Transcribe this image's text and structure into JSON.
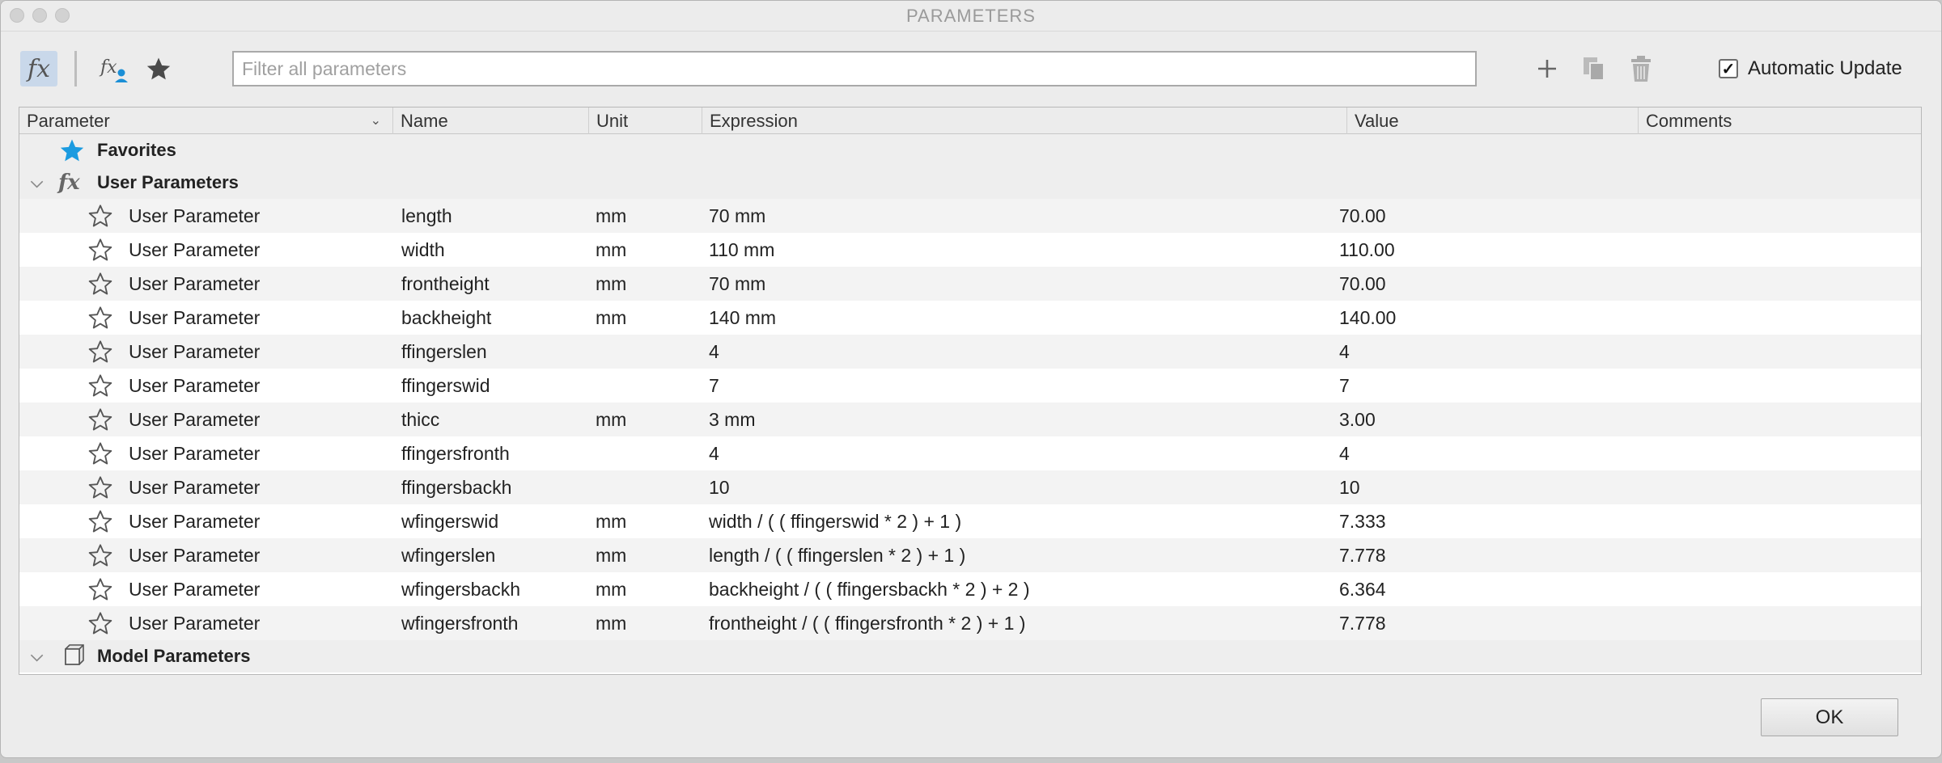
{
  "window": {
    "title": "PARAMETERS"
  },
  "toolbar": {
    "search_placeholder": "Filter all parameters",
    "auto_update_label": "Automatic Update",
    "auto_update_checked": true,
    "icons": [
      "fx-icon",
      "user-fx-icon",
      "star-icon",
      "plus-icon",
      "copy-icon",
      "trash-icon"
    ]
  },
  "columns": [
    "Parameter",
    "Name",
    "Unit",
    "Expression",
    "Value",
    "Comments"
  ],
  "groups": {
    "favorites": "Favorites",
    "user": "User Parameters",
    "model": "Model Parameters"
  },
  "rows": [
    {
      "parameter": "User Parameter",
      "name": "length",
      "unit": "mm",
      "expression": "70 mm",
      "value": "70.00",
      "comments": ""
    },
    {
      "parameter": "User Parameter",
      "name": "width",
      "unit": "mm",
      "expression": "110 mm",
      "value": "110.00",
      "comments": ""
    },
    {
      "parameter": "User Parameter",
      "name": "frontheight",
      "unit": "mm",
      "expression": "70 mm",
      "value": "70.00",
      "comments": ""
    },
    {
      "parameter": "User Parameter",
      "name": "backheight",
      "unit": "mm",
      "expression": "140 mm",
      "value": "140.00",
      "comments": ""
    },
    {
      "parameter": "User Parameter",
      "name": "ffingerslen",
      "unit": "",
      "expression": "4",
      "value": "4",
      "comments": ""
    },
    {
      "parameter": "User Parameter",
      "name": "ffingerswid",
      "unit": "",
      "expression": "7",
      "value": "7",
      "comments": ""
    },
    {
      "parameter": "User Parameter",
      "name": "thicc",
      "unit": "mm",
      "expression": "3 mm",
      "value": "3.00",
      "comments": ""
    },
    {
      "parameter": "User Parameter",
      "name": "ffingersfronth",
      "unit": "",
      "expression": "4",
      "value": "4",
      "comments": ""
    },
    {
      "parameter": "User Parameter",
      "name": "ffingersbackh",
      "unit": "",
      "expression": "10",
      "value": "10",
      "comments": ""
    },
    {
      "parameter": "User Parameter",
      "name": "wfingerswid",
      "unit": "mm",
      "expression": "width / ( ( ffingerswid * 2 ) + 1 )",
      "value": "7.333",
      "comments": ""
    },
    {
      "parameter": "User Parameter",
      "name": "wfingerslen",
      "unit": "mm",
      "expression": "length / ( ( ffingerslen * 2 ) + 1 )",
      "value": "7.778",
      "comments": ""
    },
    {
      "parameter": "User Parameter",
      "name": "wfingersbackh",
      "unit": "mm",
      "expression": "backheight / ( ( ffingersbackh * 2 ) + 2 )",
      "value": "6.364",
      "comments": ""
    },
    {
      "parameter": "User Parameter",
      "name": "wfingersfronth",
      "unit": "mm",
      "expression": "frontheight / ( ( ffingersfronth * 2 ) + 1 )",
      "value": "7.778",
      "comments": ""
    }
  ],
  "footer": {
    "ok_label": "OK"
  },
  "colors": {
    "accent_star": "#1b9be0",
    "selected_tool": "#c9d8ea"
  }
}
